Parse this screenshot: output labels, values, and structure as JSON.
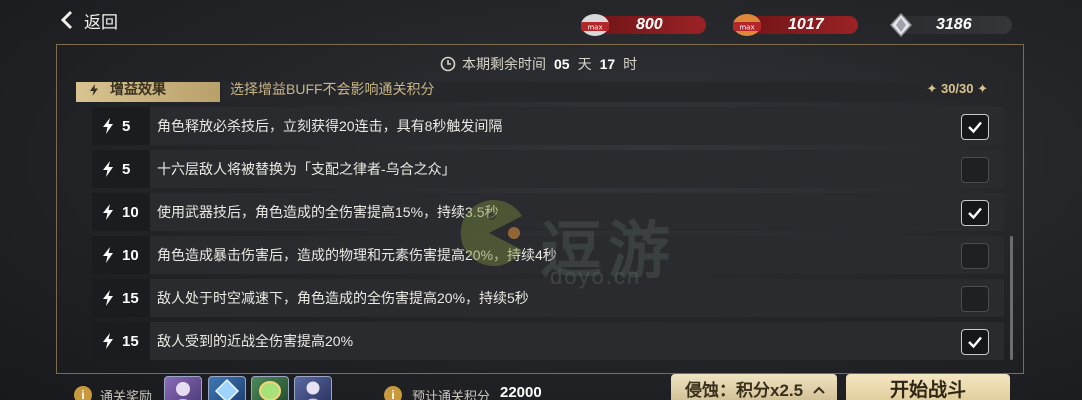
{
  "top_bar": {
    "back_label": "返回",
    "resources": [
      {
        "icon": "max-ticket-red-icon",
        "badge": "max",
        "value": "800"
      },
      {
        "icon": "max-ticket-orange-icon",
        "badge": "max",
        "value": "1017"
      },
      {
        "icon": "crystal-icon",
        "value": "3186"
      }
    ]
  },
  "timer": {
    "prefix": "本期剩余时间",
    "days": "05",
    "days_unit": "天",
    "hours": "17",
    "hours_unit": "时"
  },
  "buff_header": {
    "tab_label": "增益效果",
    "description": "选择增益BUFF不会影响通关积分",
    "count": "✦ 30/30 ✦"
  },
  "buffs": [
    {
      "level": "5",
      "text": "角色释放必杀技后，立刻获得20连击，具有8秒触发间隔",
      "checked": true
    },
    {
      "level": "5",
      "text": "十六层敌人将被替换为「支配之律者-乌合之众」",
      "checked": false
    },
    {
      "level": "10",
      "text": "使用武器技后，角色造成的全伤害提高15%，持续3.5秒",
      "checked": true
    },
    {
      "level": "10",
      "text": "角色造成暴击伤害后，造成的物理和元素伤害提高20%，持续4秒",
      "checked": false
    },
    {
      "level": "15",
      "text": "敌人处于时空减速下，角色造成的全伤害提高20%，持续5秒",
      "checked": false
    },
    {
      "level": "15",
      "text": "敌人受到的近战全伤害提高20%",
      "checked": true
    }
  ],
  "watermark": {
    "main": "逗游",
    "sub": "doyo.cn"
  },
  "bottom": {
    "reward_label": "通关奖励",
    "reward_icons": [
      "character-avatar-icon",
      "blue-crystal-icon",
      "green-orb-icon",
      "valkyrie-avatar-icon"
    ],
    "score_label": "预计通关积分",
    "score_value": "22000",
    "erosion_button": "侵蚀：积分x2.5",
    "start_button": "开始战斗"
  },
  "colors": {
    "accent_gold": "#d8c491",
    "resource_red": "#9a2225",
    "frame_border": "#7d6d48"
  }
}
